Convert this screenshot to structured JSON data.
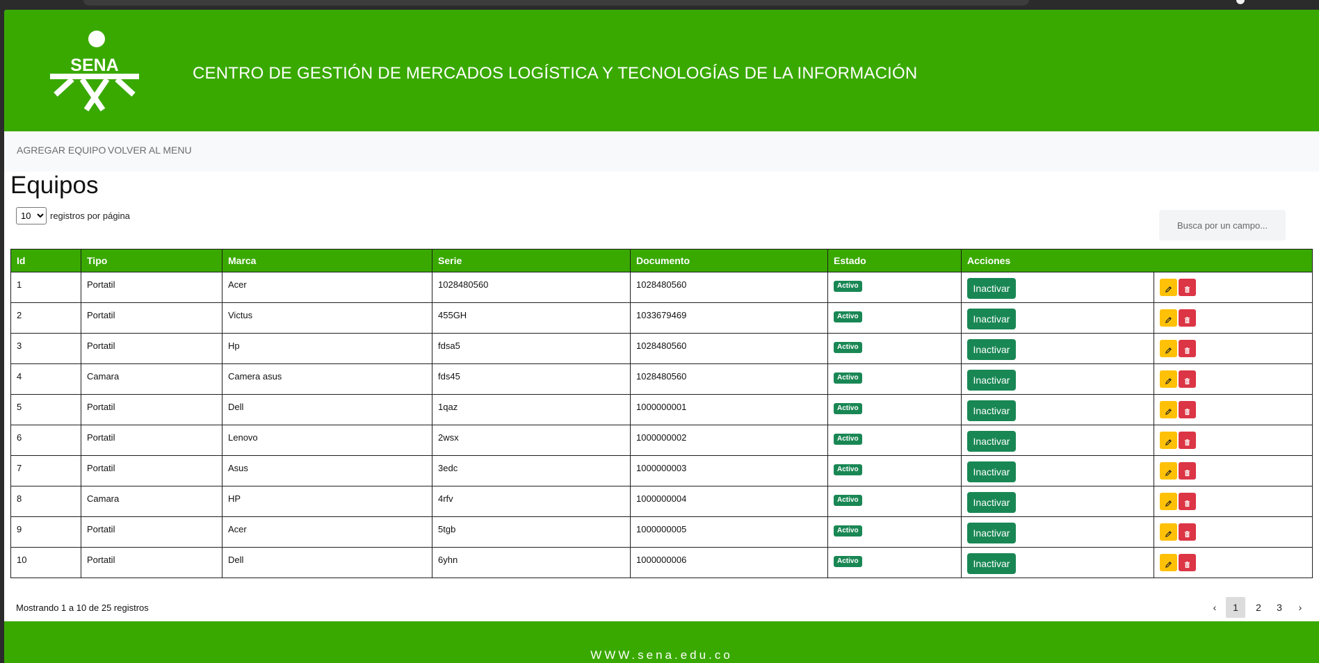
{
  "brand": {
    "logo_text": "SENA",
    "header_title": "CENTRO DE GESTIÓN DE MERCADOS LOGÍSTICA Y TECNOLOGÍAS DE LA INFORMACIÓN",
    "primary_color": "#39a900"
  },
  "nav": {
    "add_equipment": "AGREGAR EQUIPO",
    "back_to_menu": "VOLVER AL MENU"
  },
  "page": {
    "title": "Equipos",
    "page_length": "10",
    "page_length_label": "registros por página",
    "search_placeholder": "Busca por un campo..."
  },
  "table": {
    "columns": [
      "Id",
      "Tipo",
      "Marca",
      "Serie",
      "Documento",
      "Estado",
      "Acciones"
    ],
    "rows": [
      {
        "id": "1",
        "tipo": "Portatil",
        "marca": "Acer",
        "serie": "1028480560",
        "documento": "1028480560",
        "estado": "Activo",
        "accion": "Inactivar"
      },
      {
        "id": "2",
        "tipo": "Portatil",
        "marca": "Victus",
        "serie": "455GH",
        "documento": "1033679469",
        "estado": "Activo",
        "accion": "Inactivar"
      },
      {
        "id": "3",
        "tipo": "Portatil",
        "marca": "Hp",
        "serie": "fdsa5",
        "documento": "1028480560",
        "estado": "Activo",
        "accion": "Inactivar"
      },
      {
        "id": "4",
        "tipo": "Camara",
        "marca": "Camera asus",
        "serie": "fds45",
        "documento": "1028480560",
        "estado": "Activo",
        "accion": "Inactivar"
      },
      {
        "id": "5",
        "tipo": "Portatil",
        "marca": "Dell",
        "serie": "1qaz",
        "documento": "1000000001",
        "estado": "Activo",
        "accion": "Inactivar"
      },
      {
        "id": "6",
        "tipo": "Portatil",
        "marca": "Lenovo",
        "serie": "2wsx",
        "documento": "1000000002",
        "estado": "Activo",
        "accion": "Inactivar"
      },
      {
        "id": "7",
        "tipo": "Portatil",
        "marca": "Asus",
        "serie": "3edc",
        "documento": "1000000003",
        "estado": "Activo",
        "accion": "Inactivar"
      },
      {
        "id": "8",
        "tipo": "Camara",
        "marca": "HP",
        "serie": "4rfv",
        "documento": "1000000004",
        "estado": "Activo",
        "accion": "Inactivar"
      },
      {
        "id": "9",
        "tipo": "Portatil",
        "marca": "Acer",
        "serie": "5tgb",
        "documento": "1000000005",
        "estado": "Activo",
        "accion": "Inactivar"
      },
      {
        "id": "10",
        "tipo": "Portatil",
        "marca": "Dell",
        "serie": "6yhn",
        "documento": "1000000006",
        "estado": "Activo",
        "accion": "Inactivar"
      }
    ]
  },
  "pagination": {
    "info": "Mostrando 1 a 10 de 25 registros",
    "prev": "‹",
    "pages": [
      "1",
      "2",
      "3"
    ],
    "current": "1",
    "next": "›"
  },
  "footer": {
    "url": "WWW.sena.edu.co"
  },
  "icons": {
    "edit": "pencil-icon",
    "delete": "trash-icon"
  },
  "colors": {
    "badge_green": "#198754",
    "edit_yellow": "#ffc107",
    "delete_red": "#dc3545"
  }
}
